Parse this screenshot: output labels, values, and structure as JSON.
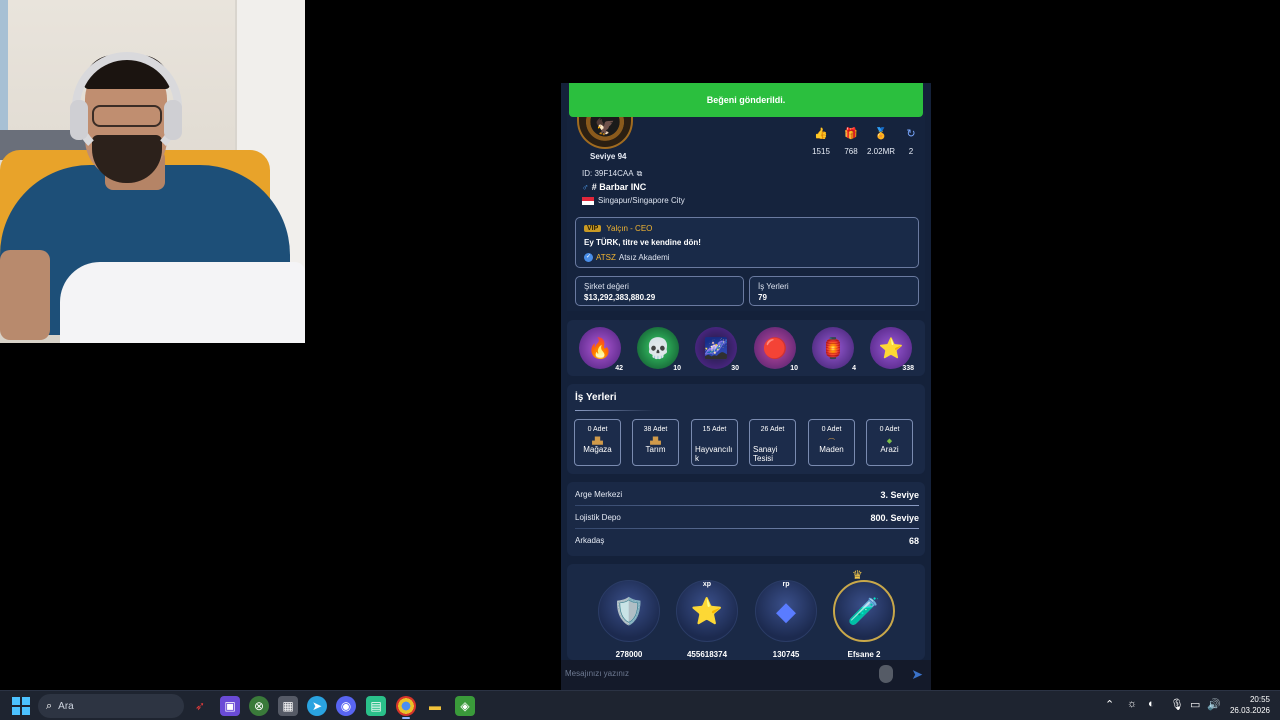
{
  "toast": "Beğeni gönderildi.",
  "profile": {
    "level": "Seviye 94",
    "id": "ID: 39F14CAA",
    "company": "# Barbar INC",
    "city": "Singapur/Singapore City",
    "stats": [
      {
        "icon": "thumbs-up-icon",
        "value": "1515"
      },
      {
        "icon": "gift-icon",
        "value": "768"
      },
      {
        "icon": "badge-icon",
        "value": "2.02MR"
      },
      {
        "icon": "refresh-icon",
        "value": "2"
      }
    ]
  },
  "ceo": {
    "vip": "VIP",
    "name": "Yalçın - CEO",
    "motto": "Ey TÜRK, titre ve kendine dön!",
    "tag": "ATSZ",
    "academy": "Atsız Akademi"
  },
  "company_value": {
    "label": "Şirket değeri",
    "value": "$13,292,383,880.29"
  },
  "workplaces_count": {
    "label": "İş Yerleri",
    "value": "79"
  },
  "items": [
    {
      "name": "fire-gem-icon",
      "count": "42",
      "color": "#7a3bb0",
      "glyph": "🔥"
    },
    {
      "name": "skull-gem-icon",
      "count": "10",
      "color": "#1f8a4a",
      "glyph": "💀"
    },
    {
      "name": "galaxy-gem-icon",
      "count": "30",
      "color": "#3a2a7a",
      "glyph": "🌌"
    },
    {
      "name": "ruby-gem-icon",
      "count": "10",
      "color": "#8a2a5a",
      "glyph": "💎"
    },
    {
      "name": "lantern-icon",
      "count": "4",
      "color": "#6a3a9a",
      "glyph": "🏮"
    },
    {
      "name": "star-icon",
      "count": "338",
      "color": "#7a3bb0",
      "glyph": "⭐"
    }
  ],
  "work": {
    "title": "İş Yerleri",
    "cards": [
      {
        "qty": "0 Adet",
        "name": "Mağaza",
        "left": false
      },
      {
        "qty": "38 Adet",
        "name": "Tarım",
        "left": false
      },
      {
        "qty": "15 Adet",
        "name": "Hayvancılı k",
        "left": true
      },
      {
        "qty": "26 Adet",
        "name": "Sanayi Tesisi",
        "left": true
      },
      {
        "qty": "0 Adet",
        "name": "Maden",
        "left": false
      },
      {
        "qty": "0 Adet",
        "name": "Arazi",
        "left": false
      }
    ]
  },
  "info": [
    {
      "key": "Arge Merkezi",
      "value": "3. Seviye"
    },
    {
      "key": "Lojistik Depo",
      "value": "800. Seviye"
    },
    {
      "key": "Arkadaş",
      "value": "68"
    }
  ],
  "bottom": [
    {
      "name": "shield-badge-icon",
      "top": "",
      "value": "278000",
      "glyph": "🛡️"
    },
    {
      "name": "xp-star-icon",
      "top": "xp",
      "value": "455618374",
      "glyph": "⭐"
    },
    {
      "name": "rp-crystal-icon",
      "top": "rp",
      "value": "130745",
      "glyph": "🔷"
    },
    {
      "name": "potion-icon",
      "top": "",
      "value": "Efsane 2",
      "glyph": "🧪"
    }
  ],
  "message": {
    "placeholder": "Mesajınızı yazınız"
  },
  "taskbar": {
    "search": "Ara",
    "time": "20:55",
    "date": "26.03.2026"
  }
}
